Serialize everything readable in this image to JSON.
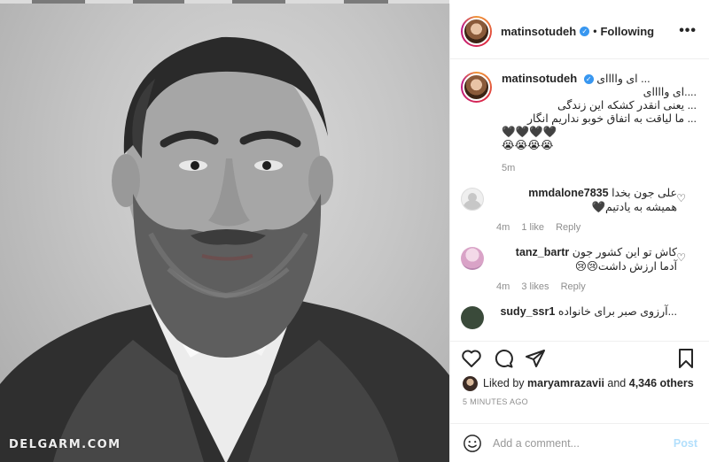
{
  "watermark": "DELGARM.COM",
  "post": {
    "username": "matinsotudeh",
    "separator": "•",
    "follow_status": "Following",
    "more_icon": "more-horizontal-icon"
  },
  "caption": {
    "username": "matinsotudeh",
    "lines": [
      "... ای واااای",
      "....ای واااای",
      "... یعنی انقدر کشکه این زندگی",
      "... ما لیاقت به اتفاق خوبو نداریم انگار",
      "🖤🖤🖤🖤",
      "😭😭😭😭"
    ],
    "time": "5m"
  },
  "comments": [
    {
      "username": "mmdalone7835",
      "lines": [
        "علی جون بخدا",
        "همیشه به یادتیم🖤"
      ],
      "time": "4m",
      "likes": "1 like",
      "reply": "Reply"
    },
    {
      "username": "tanz_bartr",
      "lines": [
        "کاش تو این کشور جون",
        "آدما ارزش داشت😢😢"
      ],
      "time": "4m",
      "likes": "3 likes",
      "reply": "Reply"
    },
    {
      "username": "sudy_ssr1",
      "lines": [
        "...آرزوی صبر برای خانواده"
      ],
      "time": "",
      "likes": "",
      "reply": ""
    }
  ],
  "likes": {
    "prefix": "Liked by",
    "user": "maryamrazavii",
    "middle": "and",
    "others": "4,346 others"
  },
  "timestamp": "5 MINUTES AGO",
  "composer": {
    "placeholder": "Add a comment...",
    "post_label": "Post"
  },
  "colors": {
    "accent": "#3897f0",
    "post_disabled": "#b2dffc",
    "muted": "#8e8e8e"
  }
}
